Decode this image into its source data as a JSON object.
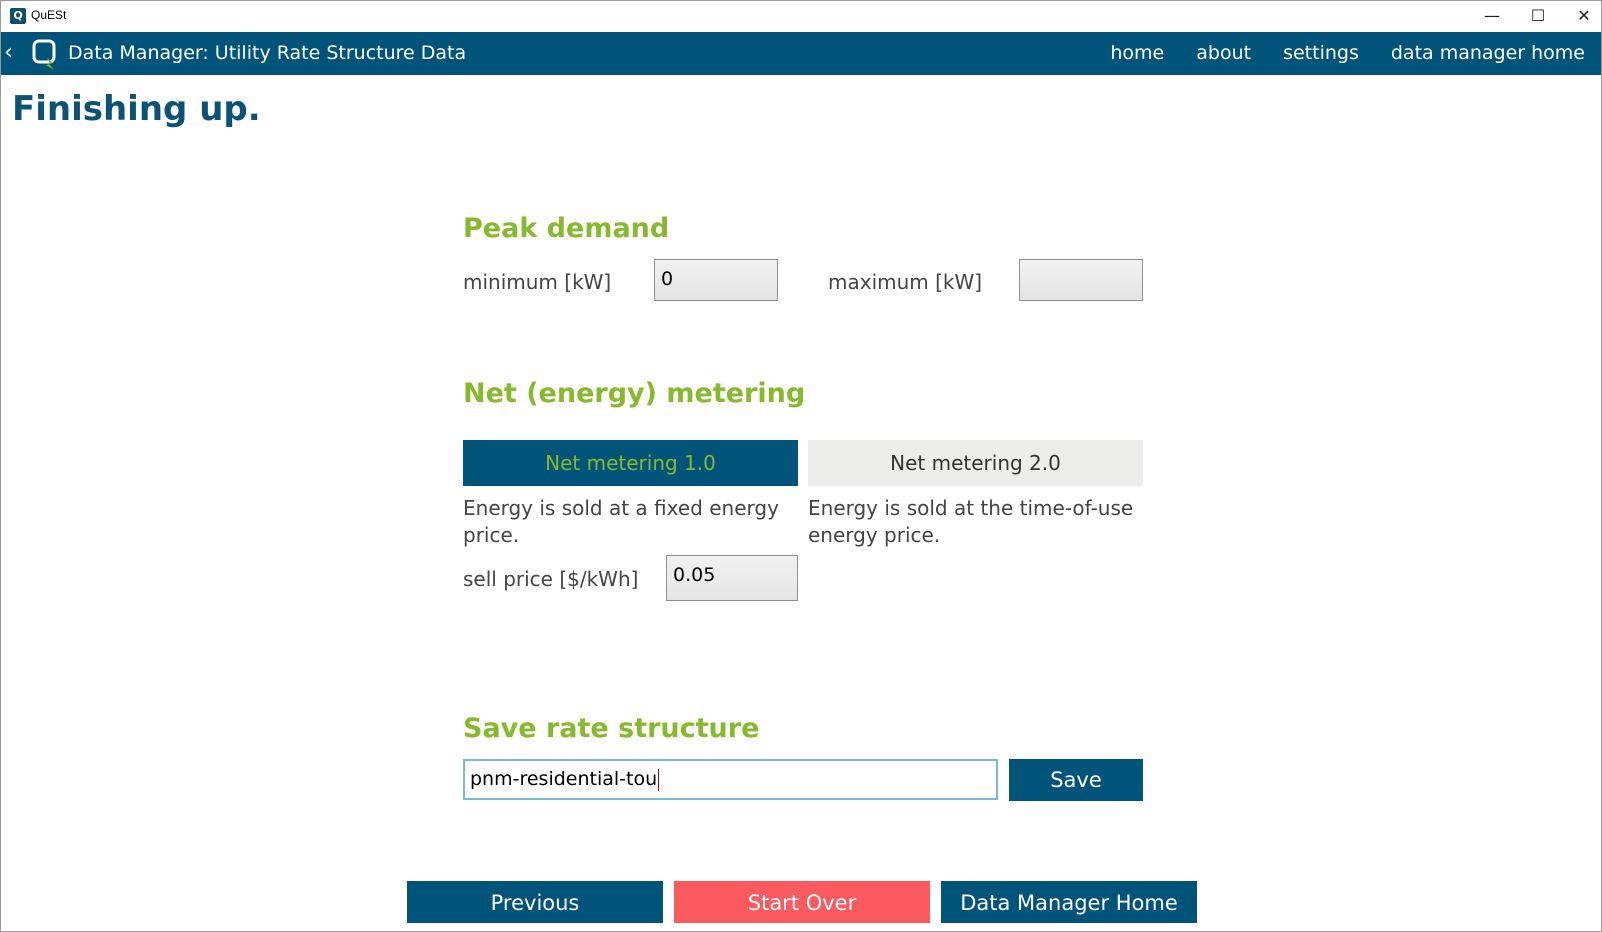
{
  "window": {
    "icon_letter": "Q",
    "title": "QuESt",
    "minimize": "—",
    "maximize": "☐",
    "close": "✕"
  },
  "navbar": {
    "back_glyph": "‹",
    "title": "Data Manager: Utility Rate Structure Data",
    "links": [
      "home",
      "about",
      "settings",
      "data manager home"
    ]
  },
  "page": {
    "title": "Finishing up."
  },
  "peak_demand": {
    "heading": "Peak demand",
    "min_label": "minimum [kW]",
    "min_value": "0",
    "max_label": "maximum [kW]",
    "max_value": ""
  },
  "net_metering": {
    "heading": "Net (energy) metering",
    "tab1_label": "Net metering 1.0",
    "tab2_label": "Net metering 2.0",
    "tab1_desc": "Energy is sold at a fixed energy price.",
    "tab2_desc": "Energy is sold at the time-of-use energy price.",
    "sell_price_label": "sell price [$/kWh]",
    "sell_price_value": "0.05",
    "selected": "Net metering 1.0"
  },
  "save": {
    "heading": "Save rate structure",
    "name_value": "pnm-residential-tou",
    "button_label": "Save"
  },
  "footer": {
    "previous_label": "Previous",
    "start_over_label": "Start Over",
    "dm_home_label": "Data Manager Home"
  },
  "colors": {
    "navy": "#00547a",
    "green": "#86b92b",
    "red": "#fb5a5f",
    "tab_inactive": "#ececea"
  }
}
